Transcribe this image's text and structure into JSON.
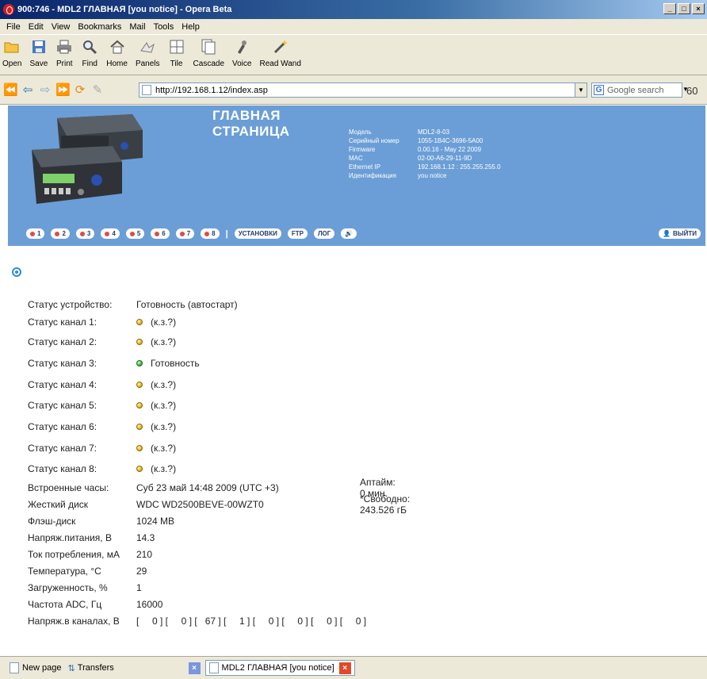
{
  "window": {
    "title": "900:746 - MDL2 ГЛАВНАЯ [you notice] - Opera Beta",
    "min": "_",
    "max": "□",
    "close": "×"
  },
  "menu": [
    "File",
    "Edit",
    "View",
    "Bookmarks",
    "Mail",
    "Tools",
    "Help"
  ],
  "toolbar": [
    {
      "label": "Open",
      "icon": "folder-open-icon"
    },
    {
      "label": "Save",
      "icon": "save-icon"
    },
    {
      "label": "Print",
      "icon": "printer-icon"
    },
    {
      "label": "Find",
      "icon": "magnifier-icon"
    },
    {
      "label": "Home",
      "icon": "home-icon"
    },
    {
      "label": "Panels",
      "icon": "panels-icon"
    },
    {
      "label": "Tile",
      "icon": "tile-icon"
    },
    {
      "label": "Cascade",
      "icon": "cascade-icon"
    },
    {
      "label": "Voice",
      "icon": "voice-icon"
    },
    {
      "label": "Read Wand",
      "icon": "wand-icon"
    }
  ],
  "address": {
    "url": "http://192.168.1.12/index.asp",
    "search_placeholder": "Google search"
  },
  "header": {
    "title_line1": "ГЛАВНАЯ",
    "title_line2": "СТРАНИЦА",
    "info": [
      {
        "label": "Модель",
        "value": "MDL2-8-03"
      },
      {
        "label": "Серийный номер",
        "value": "1055-1B4C-3696-5A00"
      },
      {
        "label": "Firmware",
        "value": "0.00.16 - May 22 2009"
      },
      {
        "label": "MAC",
        "value": "02-00-A6-29-11-9D"
      },
      {
        "label": "Ethernet IP",
        "value": "192.168.1.12 : 255.255.255.0"
      },
      {
        "label": "Идентификация",
        "value": "you notice"
      }
    ],
    "channel_buttons": [
      "1",
      "2",
      "3",
      "4",
      "5",
      "6",
      "7",
      "8"
    ],
    "separator": "|",
    "settings": "УСТАНОВКИ",
    "ftp": "FTP",
    "log": "ЛОГ",
    "sound": "🔊",
    "exit": "ВЫЙТИ"
  },
  "status": {
    "device_label": "Статус устройство:",
    "device_value": "Готовность (автостарт)",
    "channels": [
      {
        "label": "Статус канал 1:",
        "state": "yellow",
        "value": "(к.з.?)"
      },
      {
        "label": "Статус канал 2:",
        "state": "yellow",
        "value": "(к.з.?)"
      },
      {
        "label": "Статус канал 3:",
        "state": "green",
        "value": "Готовность"
      },
      {
        "label": "Статус канал 4:",
        "state": "yellow",
        "value": "(к.з.?)"
      },
      {
        "label": "Статус канал 5:",
        "state": "yellow",
        "value": "(к.з.?)"
      },
      {
        "label": "Статус канал 6:",
        "state": "yellow",
        "value": "(к.з.?)"
      },
      {
        "label": "Статус канал 7:",
        "state": "yellow",
        "value": "(к.з.?)"
      },
      {
        "label": "Статус канал 8:",
        "state": "yellow",
        "value": "(к.з.?)"
      }
    ],
    "clock_label": "Встроенные часы:",
    "clock_value": "Суб 23 май 14:48 2009  (UTC +3)",
    "uptime": "Аптайм: 0 мин.",
    "hdd_label": "Жесткий диск",
    "hdd_value": "WDC WD2500BEVE-00WZT0",
    "hdd_free": "*Свободно: 243.526 гБ",
    "flash_label": "Флэш-диск",
    "flash_value": "1024 MB",
    "voltage_label": "Напряж.питания, В",
    "voltage_value": "14.3",
    "current_label": "Ток потребления, мА",
    "current_value": "210",
    "temp_label": "Температура, °С",
    "temp_value": "29",
    "load_label": "Загруженность, %",
    "load_value": "1",
    "adc_label": "Частота ADC, Гц",
    "adc_value": "16000",
    "chv_label": "Напряж.в каналах, В",
    "chv_value": "[     0 ] [     0 ] [   67 ] [     1 ] [     0 ] [     0 ] [     0 ] [     0 ]"
  },
  "tabs": {
    "new_page": "New page",
    "transfers": "Transfers",
    "active": "MDL2 ГЛАВНАЯ [you notice]"
  },
  "colors": {
    "header_bg": "#6b9ed6",
    "lamp_yellow": "#f0b000",
    "lamp_green": "#3cb43c"
  }
}
